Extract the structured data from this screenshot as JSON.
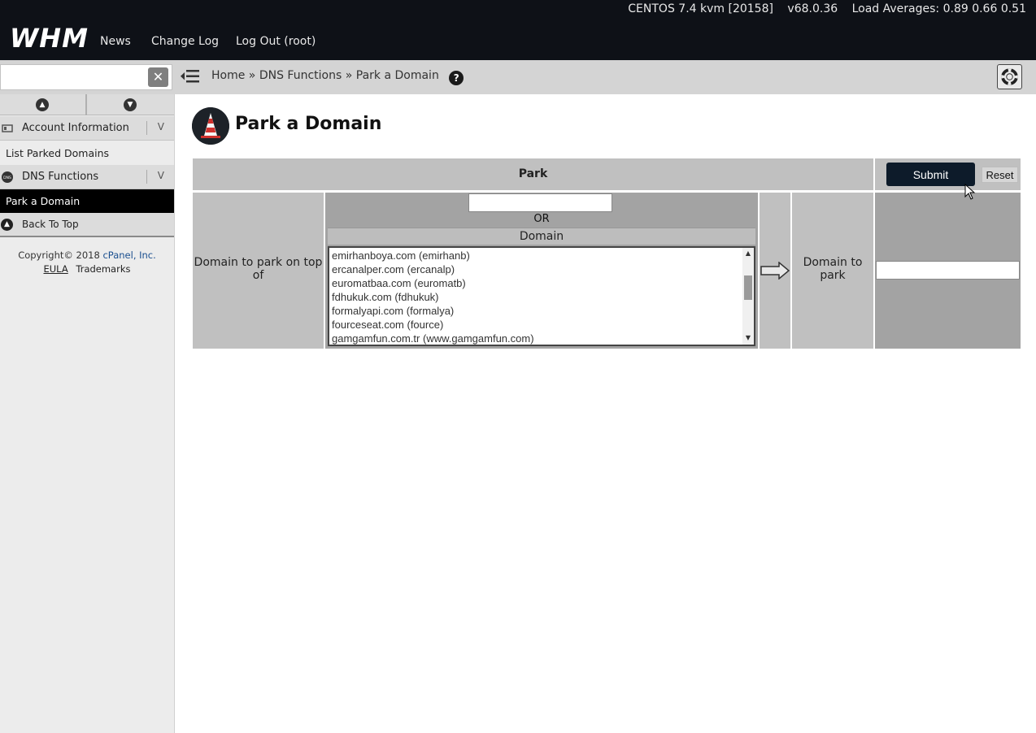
{
  "header": {
    "logo": "WHM",
    "nav": [
      "News",
      "Change Log",
      "Log Out (root)"
    ],
    "os": "CENTOS 7.4 kvm [20158]",
    "version": "v68.0.36",
    "load": "Load Averages: 0.89 0.66 0.51"
  },
  "search": {
    "placeholder": ""
  },
  "breadcrumb": {
    "home": "Home",
    "sep": "»",
    "section": "DNS Functions",
    "current": "Park a Domain",
    "help": "?"
  },
  "sidebar": {
    "cat1": "Account Information",
    "cat1_item": "List Parked Domains",
    "cat2": "DNS Functions",
    "cat2_item": "Park a Domain",
    "chevron": "V",
    "back": "Back To Top",
    "copyright": "Copyright© 2018",
    "brand": "cPanel, Inc.",
    "eula": "EULA",
    "trademarks": "Trademarks"
  },
  "page": {
    "title": "Park a Domain"
  },
  "form": {
    "header": "Park",
    "submit": "Submit",
    "reset": "Reset",
    "label_ontop": "Domain to park on top of",
    "or": "OR",
    "domain_header": "Domain",
    "label_park": "Domain to park",
    "domain_options": [
      "emirhanboya.com (emirhanb)",
      "ercanalper.com (ercanalp)",
      "euromatbaa.com (euromatb)",
      "fdhukuk.com (fdhukuk)",
      "formalyapi.com (formalya)",
      "fourceseat.com (fource)",
      "gamgamfun.com.tr (www.gamgamfun.com)"
    ]
  },
  "colors": {
    "topbar": "#0e1117",
    "submit": "#0d1b2a",
    "active_item": "#000000",
    "table_cell": "#c0c0c0"
  }
}
